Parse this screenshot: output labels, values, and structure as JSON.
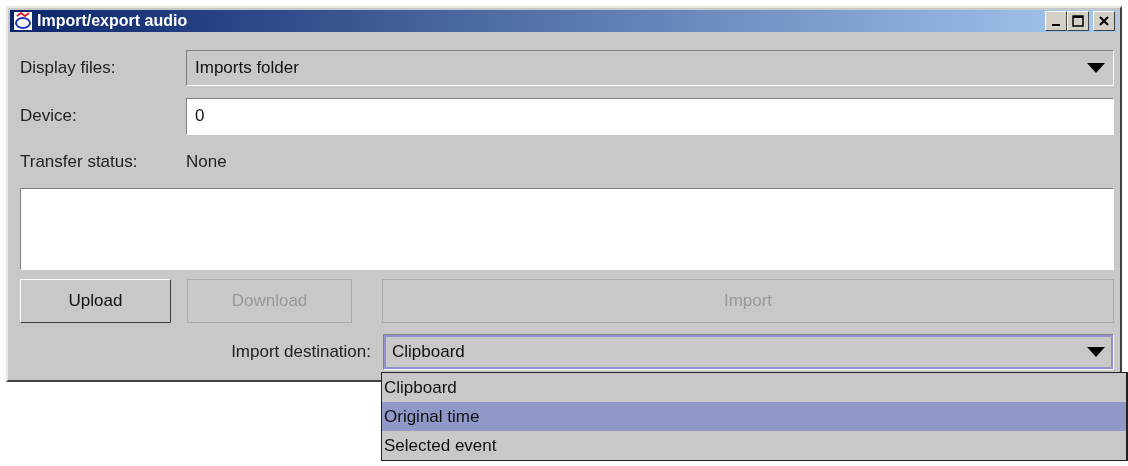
{
  "window": {
    "title": "Import/export audio"
  },
  "display_files": {
    "label": "Display files:",
    "value": "Imports folder"
  },
  "device": {
    "label": "Device:",
    "value": "0"
  },
  "transfer_status": {
    "label": "Transfer status:",
    "value": "None"
  },
  "buttons": [
    {
      "label": "Upload",
      "disabled": false
    },
    {
      "label": "Download",
      "disabled": true
    },
    {
      "label": "Import",
      "disabled": true
    }
  ],
  "import_destination": {
    "label": "Import destination:",
    "value": "Clipboard",
    "expanded": true,
    "options": [
      {
        "label": "Clipboard",
        "highlighted": false
      },
      {
        "label": "Original time",
        "highlighted": true
      },
      {
        "label": "Selected event",
        "highlighted": false
      }
    ]
  }
}
